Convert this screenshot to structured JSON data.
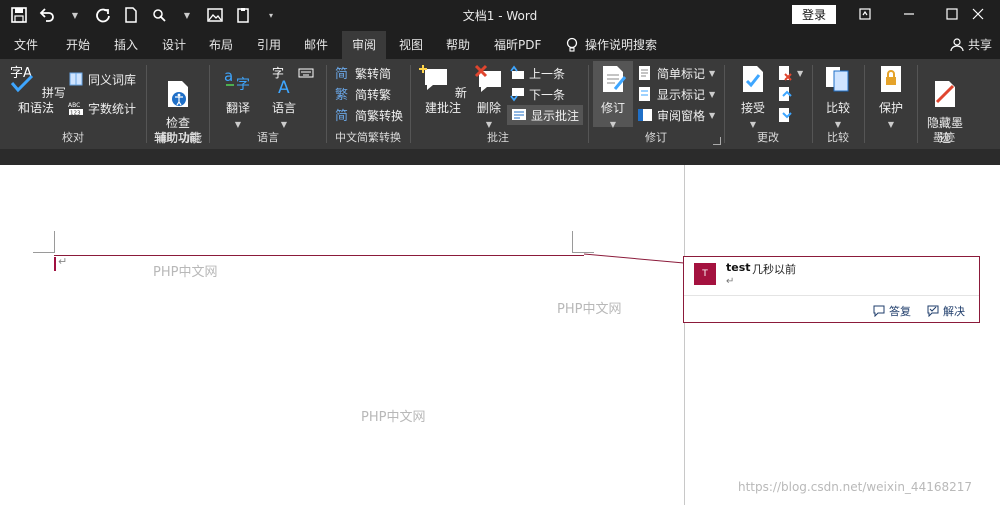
{
  "window": {
    "title": "文档1  -  Word",
    "login_label": "登录",
    "share_label": "共享"
  },
  "tabs": [
    "文件",
    "开始",
    "插入",
    "设计",
    "布局",
    "引用",
    "邮件",
    "审阅",
    "视图",
    "帮助",
    "福昕PDF"
  ],
  "active_tab": "审阅",
  "tell_me": "操作说明搜索",
  "ribbon": {
    "proofing": {
      "label": "校对",
      "spelling": "拼写和语法",
      "thesaurus": "同义词库",
      "word_count": "字数统计"
    },
    "accessibility": {
      "label": "辅助功能",
      "check": "检查\n辅助功能"
    },
    "language": {
      "label": "语言",
      "translate": "翻译",
      "language": "语言"
    },
    "chinese_conversion": {
      "label": "中文简繁转换",
      "to_simplified": "繁转简",
      "to_traditional": "简转繁",
      "convert": "简繁转换"
    },
    "comments": {
      "label": "批注",
      "new": "新建批注",
      "delete": "删除",
      "previous": "上一条",
      "next": "下一条",
      "show": "显示批注"
    },
    "tracking": {
      "label": "修订",
      "track": "修订",
      "simple_markup": "简单标记",
      "show_markup": "显示标记",
      "reviewing_pane": "审阅窗格"
    },
    "changes": {
      "label": "更改",
      "accept": "接受"
    },
    "compare": {
      "label": "比较",
      "compare": "比较"
    },
    "protect": {
      "label": "保护",
      "protect": "保护"
    },
    "ink": {
      "label": "墨迹",
      "hide_ink": "隐藏墨\n迹"
    }
  },
  "document": {
    "paragraph_mark": "↵",
    "watermarks": [
      "PHP中文网",
      "PHP中文网",
      "PHP中文网"
    ],
    "comment": {
      "avatar_letter": "T",
      "author": "test",
      "time": "几秒以前",
      "reply": "答复",
      "resolve": "解决"
    },
    "source_watermark": "https://blog.csdn.net/weixin_44168217"
  },
  "colors": {
    "accent": "#a4123f",
    "ribbon_bg": "#3a3a3a",
    "titlebar_bg": "#1f1f1f"
  }
}
